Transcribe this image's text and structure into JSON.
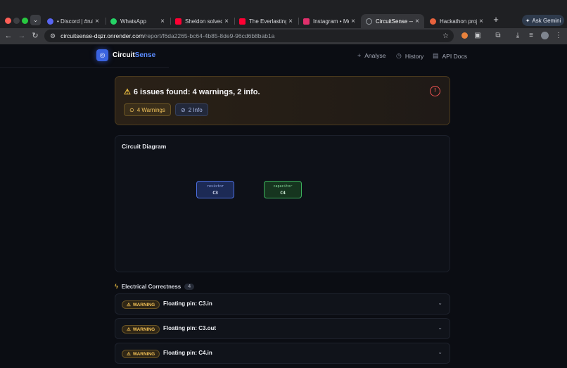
{
  "browser": {
    "tabs": [
      {
        "title": "• Discord | #rules",
        "fav_color": "#5865f2"
      },
      {
        "title": "WhatsApp",
        "fav_color": "#25d366"
      },
      {
        "title": "Sheldon solved",
        "fav_color": "#ff0033"
      },
      {
        "title": "The Everlasting",
        "fav_color": "#ff0033"
      },
      {
        "title": "Instagram • Mess",
        "fav_color": "#e1306c"
      },
      {
        "title": "CircuitSense — A",
        "fav_color": "#9aa0a6"
      },
      {
        "title": "Hackathon proje",
        "fav_color": "#e8623d"
      }
    ],
    "active_tab": 5,
    "gemini_label": "Ask Gemini",
    "url_host": "circuitsense-dqzr.onrender.com",
    "url_path": "/report/f6da2265-bc64-4b85-8de9-96cd6b8bab1a"
  },
  "app": {
    "brand_part1": "Circuit",
    "brand_part2": "Sense",
    "nav": [
      {
        "label": "Analyse",
        "icon": "plus-icon"
      },
      {
        "label": "History",
        "icon": "history-icon"
      },
      {
        "label": "API Docs",
        "icon": "docs-icon"
      }
    ]
  },
  "summary": {
    "title": "6 issues found: 4 warnings, 2 info.",
    "warnings_label": "4 Warnings",
    "info_label": "2 Info"
  },
  "diagram": {
    "title": "Circuit Diagram",
    "components": [
      {
        "type": "resistor",
        "name": "C3"
      },
      {
        "type": "capacitor",
        "name": "C4"
      }
    ]
  },
  "section": {
    "title": "Electrical Correctness",
    "count": "4"
  },
  "issues": [
    {
      "badge": "WARNING",
      "text": "Floating pin: C3.in"
    },
    {
      "badge": "WARNING",
      "text": "Floating pin: C3.out"
    },
    {
      "badge": "WARNING",
      "text": "Floating pin: C4.in"
    }
  ],
  "colors": {
    "accent": "#5b8cff",
    "warning": "#f2c35b",
    "error": "#ee5252",
    "resistor": "#4c6fe0",
    "capacitor": "#3bb05c"
  }
}
